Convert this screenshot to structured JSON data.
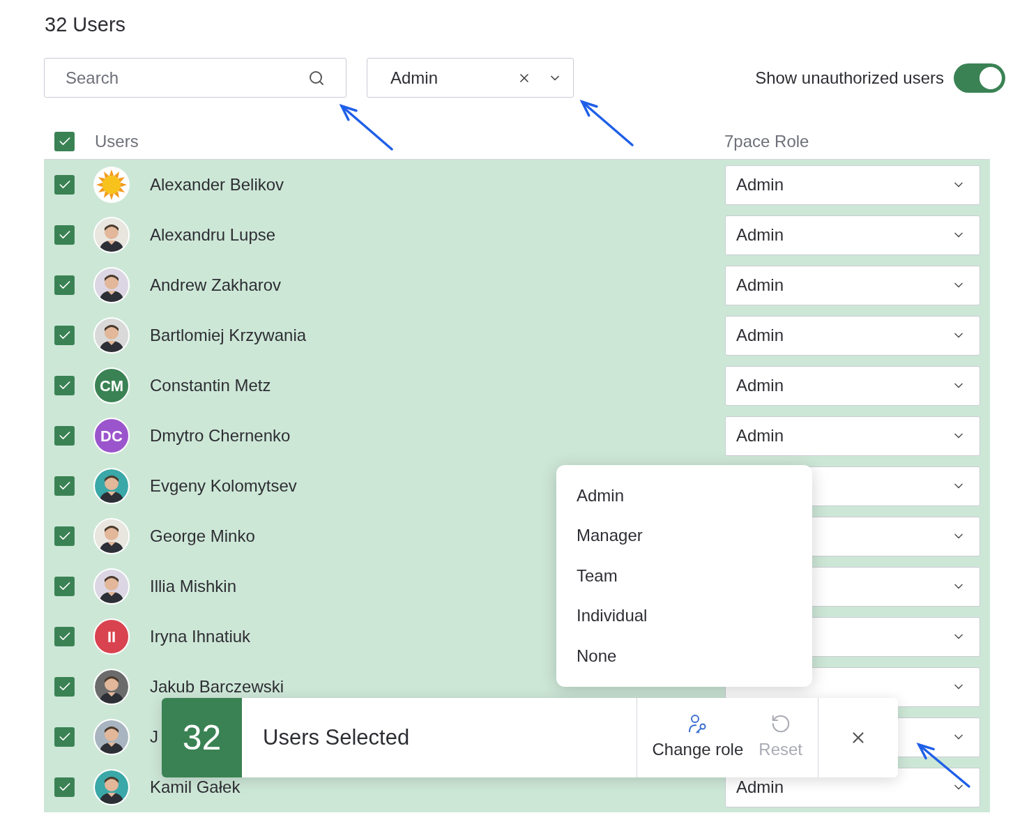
{
  "title": "32 Users",
  "search": {
    "placeholder": "Search"
  },
  "role_filter": {
    "value": "Admin"
  },
  "show_unauthorized": {
    "label": "Show unauthorized users",
    "on": true
  },
  "header": {
    "checked": true,
    "columns": [
      "Users",
      "7pace Role"
    ]
  },
  "rows": [
    {
      "name": "Alexander Belikov",
      "checked": true,
      "avatar": {
        "kind": "sun"
      },
      "role": "Admin"
    },
    {
      "name": "Alexandru Lupse",
      "checked": true,
      "role": "Admin"
    },
    {
      "name": "Andrew Zakharov",
      "checked": true,
      "role": "Admin"
    },
    {
      "name": "Bartlomiej Krzywania",
      "checked": true,
      "role": "Admin"
    },
    {
      "name": "Constantin Metz",
      "checked": true,
      "avatar": {
        "kind": "initials",
        "text": "CM",
        "color": "#3a8254"
      },
      "role": "Admin"
    },
    {
      "name": "Dmytro Chernenko",
      "checked": true,
      "avatar": {
        "kind": "initials",
        "text": "DC",
        "color": "#9b55cc"
      },
      "role": "Admin"
    },
    {
      "name": "Evgeny Kolomytsev",
      "checked": true
    },
    {
      "name": "George Minko",
      "checked": true
    },
    {
      "name": "Illia Mishkin",
      "checked": true
    },
    {
      "name": "Iryna Ihnatiuk",
      "checked": true,
      "avatar": {
        "kind": "initials",
        "text": "II",
        "color": "#d8434f"
      }
    },
    {
      "name": "Jakub Barczewski",
      "checked": true
    },
    {
      "name": "J",
      "checked": true
    },
    {
      "name": "Kamil Gałek",
      "checked": true,
      "role": "Admin"
    }
  ],
  "role_menu": {
    "items": [
      "Admin",
      "Manager",
      "Team",
      "Individual",
      "None"
    ]
  },
  "selection_bar": {
    "count": "32",
    "label": "Users Selected",
    "actions": [
      {
        "kind": "change_role",
        "label": "Change role",
        "disabled": false
      },
      {
        "kind": "reset",
        "label": "Reset",
        "disabled": true
      }
    ]
  }
}
